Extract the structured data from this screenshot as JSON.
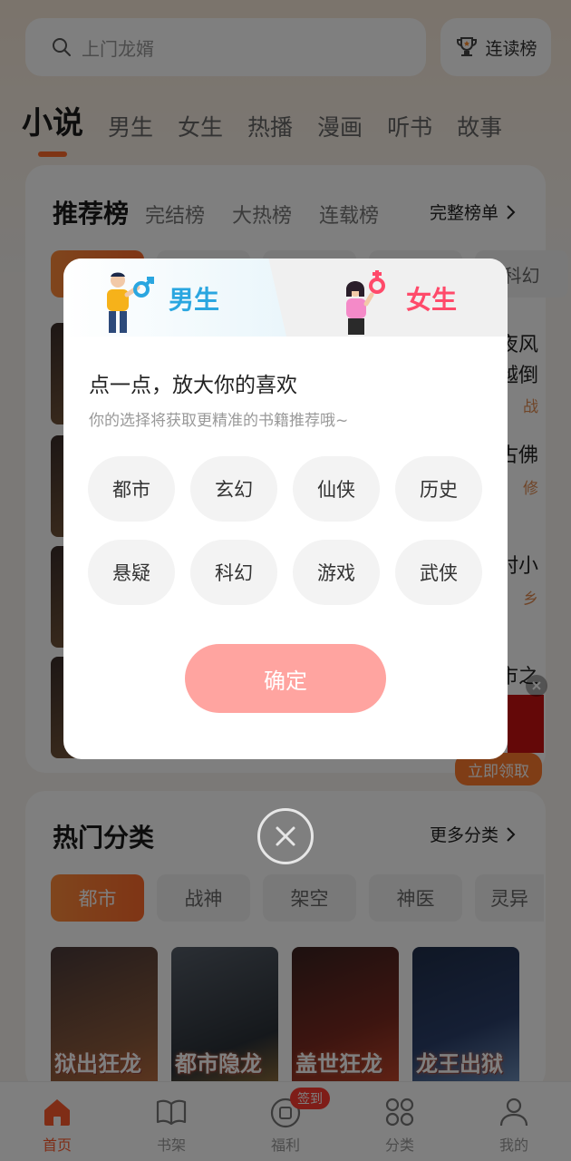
{
  "search": {
    "placeholder": "上门龙婿"
  },
  "rank_button": {
    "label": "连读榜"
  },
  "top_categories": [
    {
      "label": "小说"
    },
    {
      "label": "男生"
    },
    {
      "label": "女生"
    },
    {
      "label": "热播"
    },
    {
      "label": "漫画"
    },
    {
      "label": "听书"
    },
    {
      "label": "故事"
    }
  ],
  "recommend": {
    "title": "推荐榜",
    "tabs": [
      {
        "label": "完结榜"
      },
      {
        "label": "大热榜"
      },
      {
        "label": "连载榜"
      }
    ],
    "more_label": "完整榜单",
    "peek_chip": "科幻",
    "side_texts": [
      "夜风",
      "越倒",
      "战",
      "古佛",
      "修",
      "村小",
      "乡",
      "市之"
    ],
    "claim_label": "立即领取"
  },
  "hot_categories": {
    "title": "热门分类",
    "more_label": "更多分类",
    "chips": [
      {
        "label": "都市"
      },
      {
        "label": "战神"
      },
      {
        "label": "架空"
      },
      {
        "label": "神医"
      },
      {
        "label": "灵异"
      }
    ],
    "covers": [
      {
        "title": "狱出狂龙"
      },
      {
        "title": "都市隐龙"
      },
      {
        "title": "盖世狂龙"
      },
      {
        "title": "龙王出狱"
      }
    ]
  },
  "bottom_nav": [
    {
      "label": "首页",
      "icon": "home-icon"
    },
    {
      "label": "书架",
      "icon": "book-icon"
    },
    {
      "label": "福利",
      "icon": "gift-icon",
      "badge": "签到"
    },
    {
      "label": "分类",
      "icon": "grid-icon"
    },
    {
      "label": "我的",
      "icon": "user-icon"
    }
  ],
  "modal": {
    "tab_male": "男生",
    "tab_female": "女生",
    "heading": "点一点，放大你的喜欢",
    "subheading": "你的选择将获取更精准的书籍推荐哦~",
    "tags": [
      {
        "label": "都市"
      },
      {
        "label": "玄幻"
      },
      {
        "label": "仙侠"
      },
      {
        "label": "历史"
      },
      {
        "label": "悬疑"
      },
      {
        "label": "科幻"
      },
      {
        "label": "游戏"
      },
      {
        "label": "武侠"
      }
    ],
    "confirm_label": "确定"
  },
  "colors": {
    "accent": "#ff6a2b",
    "male": "#2aa6e0",
    "female": "#ff4a6a",
    "confirm": "#ffa4a0"
  }
}
